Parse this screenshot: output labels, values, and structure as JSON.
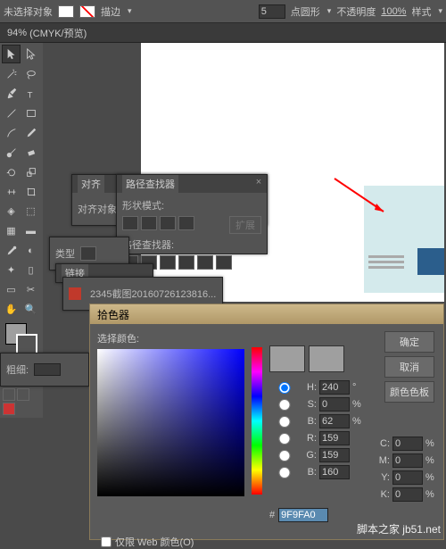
{
  "topbar": {
    "no_selection": "未选择对象",
    "stroke_label": "描边",
    "point_value": "5",
    "point_label": "点圆形",
    "opacity_label": "不透明度",
    "opacity_value": "100%",
    "style_label": "样式"
  },
  "doctab": {
    "zoom": "94%",
    "mode": "(CMYK/预览)"
  },
  "panels": {
    "align": {
      "tab": "对齐",
      "label": "对齐对象:"
    },
    "pathfinder": {
      "tab": "路径查找器",
      "mode_label": "形状模式:",
      "finder_label": "路径查找器:",
      "expand": "扩展"
    },
    "type": {
      "label": "类型"
    },
    "link": {
      "tab": "链接"
    },
    "doc": {
      "filename": "2345截图20160726123816..."
    },
    "stroke": {
      "label": "粗细:"
    }
  },
  "colorpicker": {
    "title": "拾色器",
    "select_label": "选择颜色:",
    "ok": "确定",
    "cancel": "取消",
    "swatches": "颜色色板",
    "H": {
      "l": "H:",
      "v": "240",
      "u": "°"
    },
    "S": {
      "l": "S:",
      "v": "0",
      "u": "%"
    },
    "Bv": {
      "l": "B:",
      "v": "62",
      "u": "%"
    },
    "R": {
      "l": "R:",
      "v": "159"
    },
    "G": {
      "l": "G:",
      "v": "159"
    },
    "B2": {
      "l": "B:",
      "v": "160"
    },
    "C": {
      "l": "C:",
      "v": "0",
      "u": "%"
    },
    "M": {
      "l": "M:",
      "v": "0",
      "u": "%"
    },
    "Y": {
      "l": "Y:",
      "v": "0",
      "u": "%"
    },
    "K": {
      "l": "K:",
      "v": "0",
      "u": "%"
    },
    "hex": "9F9FA0",
    "web_label": "仅限 Web 颜色(O)"
  },
  "watermark": "脚本之家 jb51.net"
}
